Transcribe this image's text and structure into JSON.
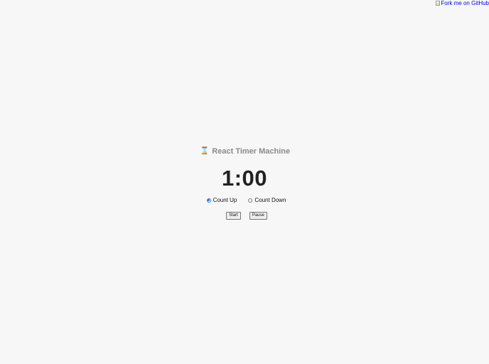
{
  "fork_link": {
    "label": "Fork me on GitHub"
  },
  "app": {
    "icon": "hourglass-icon",
    "icon_glyph": "⌛",
    "title": "React Timer Machine"
  },
  "timer": {
    "display": "1:00"
  },
  "modes": [
    {
      "label": "Count Up",
      "selected": true
    },
    {
      "label": "Count Down",
      "selected": false
    }
  ],
  "controls": {
    "start_label": "Start",
    "pause_label": "Pause"
  },
  "colors": {
    "background": "#f7f7f7",
    "title": "#8a8a8a",
    "timer": "#222222",
    "link": "#0000ee",
    "radio_selected": "#2b6fde"
  }
}
